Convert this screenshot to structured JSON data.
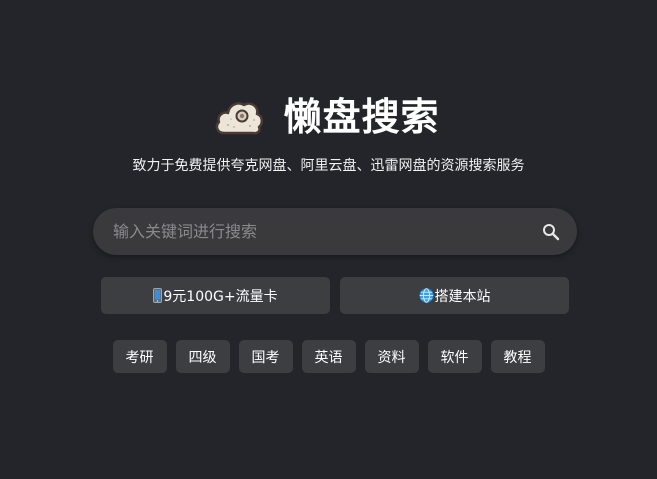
{
  "header": {
    "title": "懒盘搜索",
    "subtitle": "致力于免费提供夸克网盘、阿里云盘、迅雷网盘的资源搜索服务"
  },
  "search": {
    "placeholder": "输入关键词进行搜索",
    "value": ""
  },
  "promo_buttons": [
    {
      "icon": "mobile-phone-icon",
      "label": "9元100G+流量卡"
    },
    {
      "icon": "globe-icon",
      "label": "搭建本站"
    }
  ],
  "tags": [
    "考研",
    "四级",
    "国考",
    "英语",
    "资料",
    "软件",
    "教程"
  ],
  "colors": {
    "background": "#24252a",
    "search_box": "#3a3a3d",
    "button": "#3d3e42",
    "text": "#ffffff",
    "placeholder": "#8a8a8d"
  }
}
